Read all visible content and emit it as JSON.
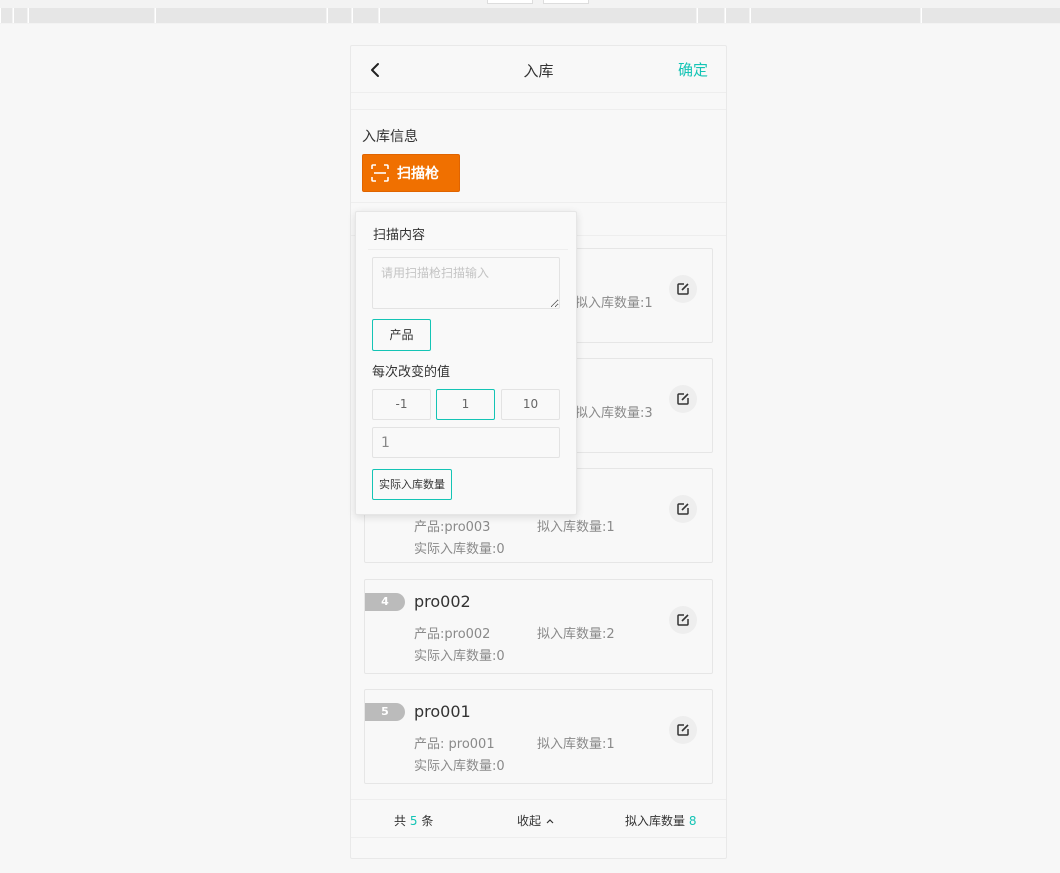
{
  "nav": {
    "title": "入库",
    "confirm": "确定"
  },
  "section": {
    "title": "入库信息",
    "scan_button": "扫描枪"
  },
  "items": [
    {
      "index": "4",
      "name": "pro002",
      "product": "产品:pro002",
      "planned": "拟入库数量:2",
      "actual": "实际入库数量:0"
    },
    {
      "index": "5",
      "name": "pro001",
      "product": "产品: pro001",
      "planned": "拟入库数量:1",
      "actual": "实际入库数量:0"
    }
  ],
  "partial_items": [
    {
      "planned": "拟入库数量:1"
    },
    {
      "planned": "拟入库数量:3"
    },
    {
      "product": "产品:pro003",
      "planned": "拟入库数量:1",
      "actual": "实际入库数量:0"
    }
  ],
  "footer": {
    "total_prefix": "共",
    "total_count": "5",
    "total_suffix": "条",
    "collapse": "收起",
    "sum_label": "拟入库数量",
    "sum_value": "8"
  },
  "popover": {
    "title": "扫描内容",
    "placeholder": "请用扫描枪扫描输入",
    "type_button": "产品",
    "step_label": "每次改变的值",
    "steps": [
      "-1",
      "1",
      "10"
    ],
    "active_step": "1",
    "value": "1",
    "target_button": "实际入库数量"
  },
  "colors": {
    "accent": "#14c4b5",
    "scan_button": "#f07000",
    "badge": "#bbbbbb"
  },
  "icons": {
    "back": "chevron-left-icon",
    "scan": "scan-icon",
    "edit": "edit-icon",
    "collapse": "chevron-up-icon"
  }
}
